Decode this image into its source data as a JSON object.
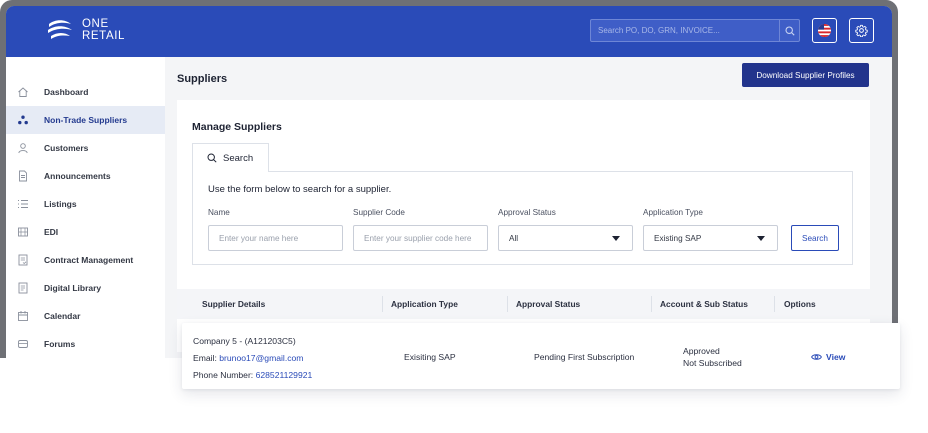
{
  "header": {
    "logo_line1": "ONE",
    "logo_line2": "RETAIL",
    "search_placeholder": "Search PO, DO, GRN, INVOICE...",
    "colors": {
      "bar": "#2a4bb8",
      "accent_dark": "#22348c"
    }
  },
  "sidebar": {
    "items": [
      {
        "label": "Dashboard",
        "icon": "home-icon"
      },
      {
        "label": "Non-Trade Suppliers",
        "icon": "network-icon",
        "active": true
      },
      {
        "label": "Customers",
        "icon": "user-icon"
      },
      {
        "label": "Announcements",
        "icon": "document-icon"
      },
      {
        "label": "Listings",
        "icon": "list-icon"
      },
      {
        "label": "EDI",
        "icon": "edi-icon"
      },
      {
        "label": "Contract Management",
        "icon": "contract-icon"
      },
      {
        "label": "Digital Library",
        "icon": "library-icon"
      },
      {
        "label": "Calendar",
        "icon": "calendar-icon"
      },
      {
        "label": "Forums",
        "icon": "forum-icon"
      }
    ]
  },
  "main": {
    "title": "Suppliers",
    "download_button": "Download Supplier Profiles",
    "card_title": "Manage Suppliers",
    "tab_label": "Search",
    "form": {
      "intro": "Use the form below to search for a supplier.",
      "name_label": "Name",
      "name_placeholder": "Enter your name here",
      "code_label": "Supplier Code",
      "code_placeholder": "Enter your supplier code here",
      "approval_label": "Approval Status",
      "approval_value": "All",
      "apptype_label": "Application Type",
      "apptype_value": "Existing SAP",
      "search_button": "Search"
    },
    "table": {
      "columns": [
        "Supplier Details",
        "Application Type",
        "Approval Status",
        "Account & Sub Status",
        "Options"
      ],
      "rows": [
        {
          "company": "Company 5 - (A121203C5)",
          "email_label": "Email: ",
          "email": "brunoo17@gmail.com",
          "phone_label": "Phone Number: ",
          "phone": "628521129921",
          "application_type": "Exisiting SAP",
          "approval_status": "Pending First Subscription",
          "account_status": "Approved",
          "sub_status": "Not Subscribed",
          "option": "View"
        }
      ]
    }
  }
}
